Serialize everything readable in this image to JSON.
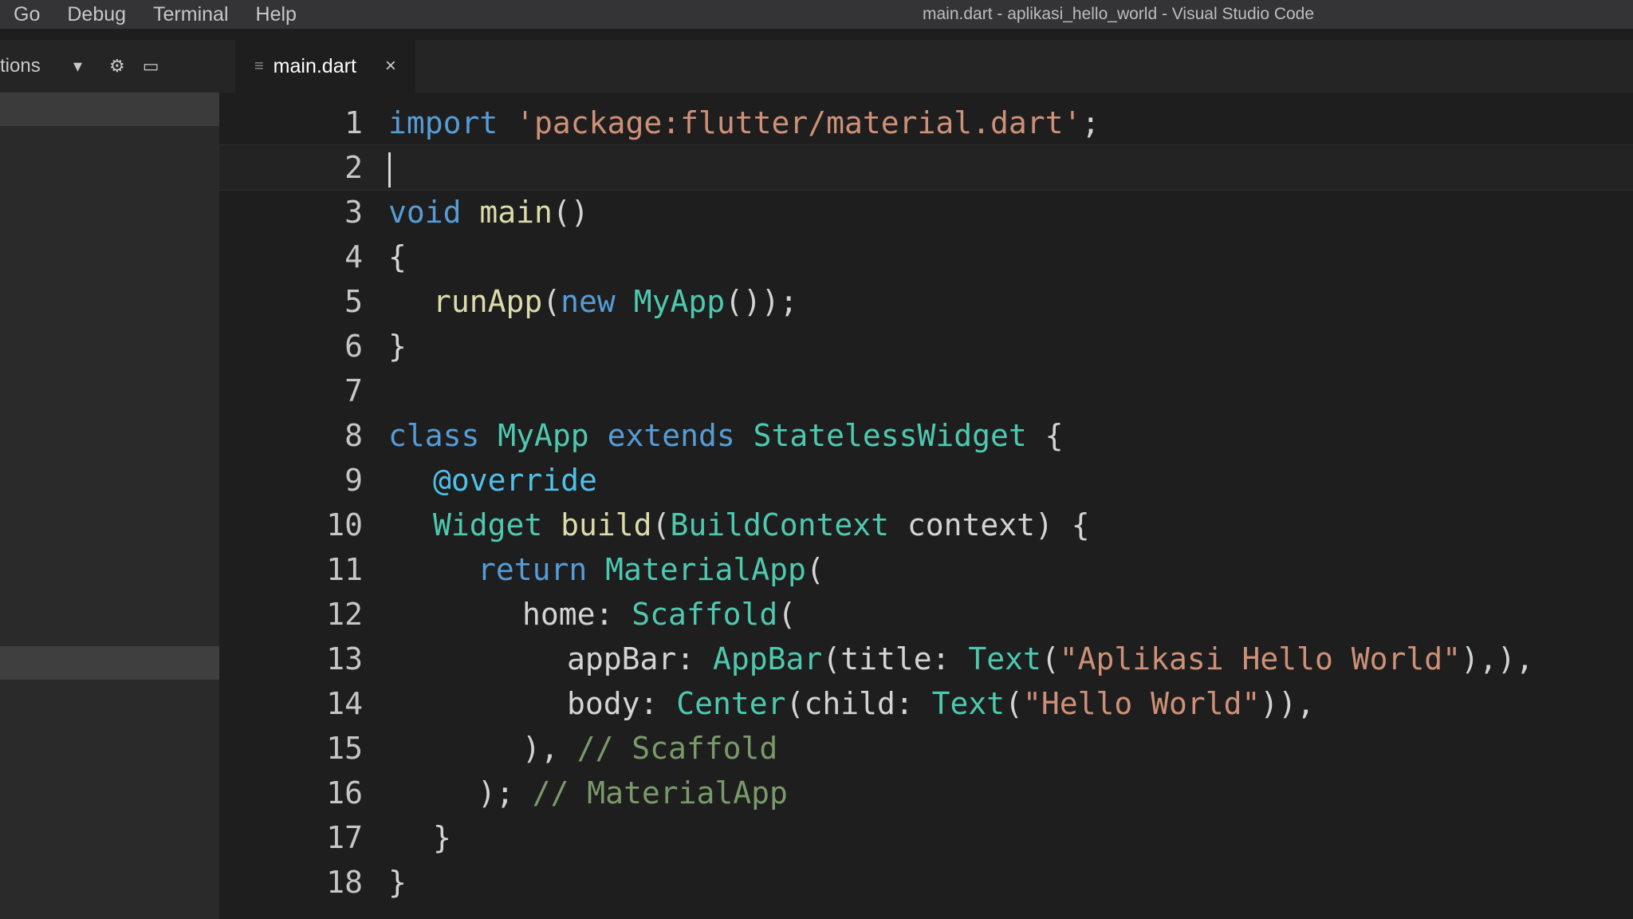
{
  "menu": {
    "items": [
      "Go",
      "Debug",
      "Terminal",
      "Help"
    ]
  },
  "window": {
    "title": "main.dart - aplikasi_hello_world - Visual Studio Code"
  },
  "sidebar": {
    "header_label": "tions",
    "icons": [
      "chevron-down-icon",
      "gear-icon",
      "split-icon"
    ]
  },
  "tabs": [
    {
      "label": "main.dart",
      "icon": "dart-file-icon",
      "close": "×"
    }
  ],
  "editor": {
    "language": "dart",
    "cursor_line": 2,
    "lines": [
      {
        "n": "1",
        "indent": 0,
        "tokens": [
          {
            "t": "import",
            "c": "kw"
          },
          {
            "t": " ",
            "c": "plain"
          },
          {
            "t": "'package:flutter/material.dart'",
            "c": "str"
          },
          {
            "t": ";",
            "c": "plain"
          }
        ]
      },
      {
        "n": "2",
        "indent": 0,
        "tokens": []
      },
      {
        "n": "3",
        "indent": 0,
        "tokens": [
          {
            "t": "void",
            "c": "kw"
          },
          {
            "t": " ",
            "c": "plain"
          },
          {
            "t": "main",
            "c": "fn"
          },
          {
            "t": "()",
            "c": "plain"
          }
        ]
      },
      {
        "n": "4",
        "indent": 0,
        "tokens": [
          {
            "t": "{",
            "c": "plain"
          }
        ]
      },
      {
        "n": "5",
        "indent": 1,
        "tokens": [
          {
            "t": "runApp",
            "c": "fn"
          },
          {
            "t": "(",
            "c": "plain"
          },
          {
            "t": "new",
            "c": "kw"
          },
          {
            "t": " ",
            "c": "plain"
          },
          {
            "t": "MyApp",
            "c": "type"
          },
          {
            "t": "());",
            "c": "plain"
          }
        ]
      },
      {
        "n": "6",
        "indent": 0,
        "tokens": [
          {
            "t": "}",
            "c": "plain"
          }
        ]
      },
      {
        "n": "7",
        "indent": 0,
        "tokens": []
      },
      {
        "n": "8",
        "indent": 0,
        "tokens": [
          {
            "t": "class",
            "c": "kw"
          },
          {
            "t": " ",
            "c": "plain"
          },
          {
            "t": "MyApp",
            "c": "type"
          },
          {
            "t": " ",
            "c": "plain"
          },
          {
            "t": "extends",
            "c": "kw"
          },
          {
            "t": " ",
            "c": "plain"
          },
          {
            "t": "StatelessWidget",
            "c": "type"
          },
          {
            "t": " {",
            "c": "plain"
          }
        ]
      },
      {
        "n": "9",
        "indent": 1,
        "tokens": [
          {
            "t": "@override",
            "c": "ann"
          }
        ]
      },
      {
        "n": "10",
        "indent": 1,
        "tokens": [
          {
            "t": "Widget",
            "c": "type"
          },
          {
            "t": " ",
            "c": "plain"
          },
          {
            "t": "build",
            "c": "fn"
          },
          {
            "t": "(",
            "c": "plain"
          },
          {
            "t": "BuildContext",
            "c": "type"
          },
          {
            "t": " context) {",
            "c": "plain"
          }
        ]
      },
      {
        "n": "11",
        "indent": 2,
        "tokens": [
          {
            "t": "return",
            "c": "kw"
          },
          {
            "t": " ",
            "c": "plain"
          },
          {
            "t": "MaterialApp",
            "c": "type"
          },
          {
            "t": "(",
            "c": "plain"
          }
        ]
      },
      {
        "n": "12",
        "indent": 3,
        "tokens": [
          {
            "t": "home: ",
            "c": "plain"
          },
          {
            "t": "Scaffold",
            "c": "type"
          },
          {
            "t": "(",
            "c": "plain"
          }
        ]
      },
      {
        "n": "13",
        "indent": 4,
        "tokens": [
          {
            "t": "appBar: ",
            "c": "plain"
          },
          {
            "t": "AppBar",
            "c": "type"
          },
          {
            "t": "(title: ",
            "c": "plain"
          },
          {
            "t": "Text",
            "c": "type"
          },
          {
            "t": "(",
            "c": "plain"
          },
          {
            "t": "\"Aplikasi Hello World\"",
            "c": "str"
          },
          {
            "t": "),),",
            "c": "plain"
          }
        ]
      },
      {
        "n": "14",
        "indent": 4,
        "tokens": [
          {
            "t": "body: ",
            "c": "plain"
          },
          {
            "t": "Center",
            "c": "type"
          },
          {
            "t": "(child: ",
            "c": "plain"
          },
          {
            "t": "Text",
            "c": "type"
          },
          {
            "t": "(",
            "c": "plain"
          },
          {
            "t": "\"Hello World\"",
            "c": "str"
          },
          {
            "t": ")),",
            "c": "plain"
          }
        ]
      },
      {
        "n": "15",
        "indent": 3,
        "tokens": [
          {
            "t": "), ",
            "c": "plain"
          },
          {
            "t": "// Scaffold",
            "c": "cm"
          }
        ]
      },
      {
        "n": "16",
        "indent": 2,
        "tokens": [
          {
            "t": "); ",
            "c": "plain"
          },
          {
            "t": "// MaterialApp",
            "c": "cm"
          }
        ]
      },
      {
        "n": "17",
        "indent": 1,
        "tokens": [
          {
            "t": "}",
            "c": "plain"
          }
        ]
      },
      {
        "n": "18",
        "indent": 0,
        "tokens": [
          {
            "t": "}",
            "c": "plain"
          }
        ]
      }
    ]
  },
  "colors": {
    "keyword": "#569cd6",
    "string": "#ce9178",
    "type": "#4ec9b0",
    "function": "#dcdcaa",
    "comment": "#7a9a6a",
    "background": "#1e1e1e"
  }
}
